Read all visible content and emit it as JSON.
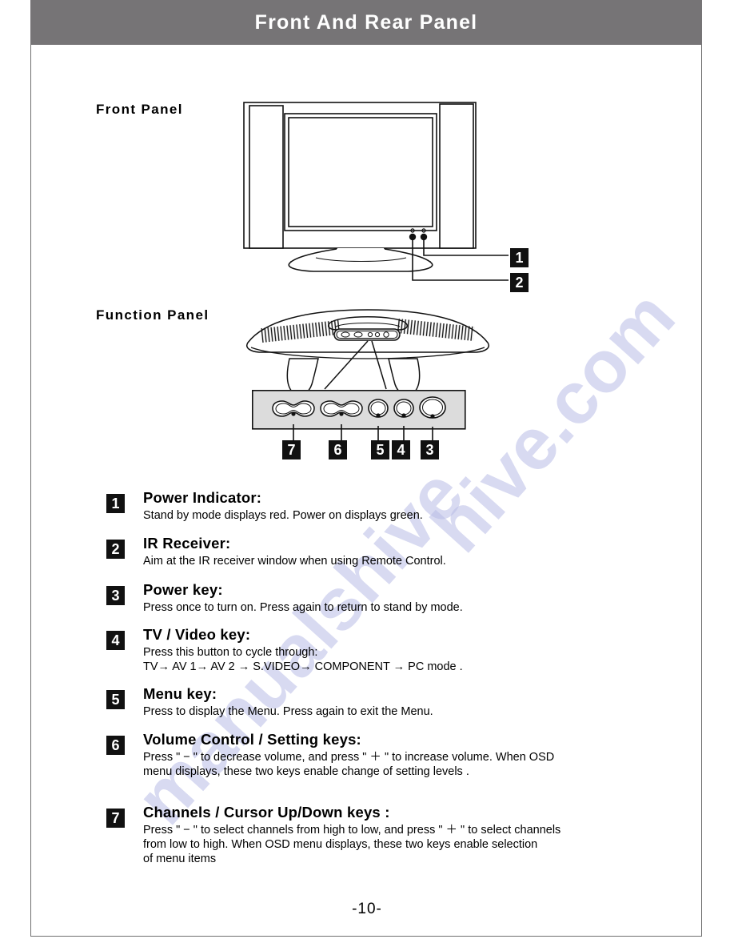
{
  "header": {
    "title": "Front And Rear Panel",
    "bar_color": "#767476",
    "text_color": "#ffffff"
  },
  "watermark": {
    "text_left": "manualshive",
    "text_right": "hive.com",
    "color": "#b9bce6"
  },
  "sections": {
    "front_panel_label": "Front  Panel",
    "function_panel_label": "Function  Panel"
  },
  "callouts": {
    "front": [
      {
        "number": "1",
        "target": "power-indicator-led"
      },
      {
        "number": "2",
        "target": "ir-receiver-window"
      }
    ],
    "function": [
      {
        "number": "7",
        "target": "channels-rocker-key"
      },
      {
        "number": "6",
        "target": "volume-rocker-key"
      },
      {
        "number": "5",
        "target": "menu-key"
      },
      {
        "number": "4",
        "target": "tv-video-key"
      },
      {
        "number": "3",
        "target": "power-key"
      }
    ]
  },
  "legend": [
    {
      "number": "1",
      "title": "Power Indicator:",
      "lines": [
        "Stand by mode displays red.  Power on displays green."
      ]
    },
    {
      "number": "2",
      "title": "IR Receiver:",
      "lines": [
        "Aim at the IR receiver window when using Remote Control."
      ]
    },
    {
      "number": "3",
      "title": "Power key:",
      "lines": [
        "Press once to turn on.  Press again to return to  stand by mode."
      ]
    },
    {
      "number": "4",
      "title": "TV / Video key:",
      "lines": [
        "Press this button to cycle through:",
        "TV→ AV 1→ AV 2 → S.VIDEO→ COMPONENT → PC mode ."
      ]
    },
    {
      "number": "5",
      "title": "Menu key:",
      "lines": [
        "Press to display the Menu.  Press again to exit the Menu."
      ]
    },
    {
      "number": "6",
      "title": "Volume Control / Setting keys:",
      "lines": [
        "Press \" − \" to decrease volume, and press \" ＋ \" to increase volume. When OSD",
        "menu displays, these two keys enable change of setting levels ."
      ]
    },
    {
      "number": "7",
      "title": "Channels / Cursor Up/Down keys :",
      "lines": [
        "Press \" − \" to select channels from high to low, and press \" ＋ \" to select channels",
        " from low to high.  When OSD menu displays, these two keys enable selection",
        "of menu items"
      ]
    }
  ],
  "footer": {
    "page_number": "-10-"
  }
}
